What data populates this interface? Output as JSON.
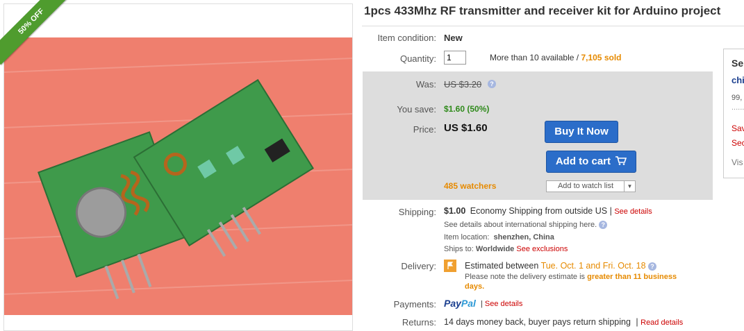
{
  "badge": {
    "discount": "50% OFF"
  },
  "product": {
    "title": "1pcs 433Mhz RF transmitter and receiver kit for Arduino project"
  },
  "condition": {
    "label": "Item condition:",
    "value": "New"
  },
  "quantity": {
    "label": "Quantity:",
    "value": "1",
    "available": "More than 10 available",
    "divider": "/",
    "sold": "7,105 sold"
  },
  "pricing": {
    "was_label": "Was:",
    "was_value": "US $3.20",
    "save_label": "You save:",
    "save_value": "$1.60 (50%)",
    "price_label": "Price:",
    "price_value": "US $1.60",
    "watchers": "485 watchers"
  },
  "actions": {
    "buy_now": "Buy It Now",
    "add_to_cart": "Add to cart",
    "watch": "Add to watch list"
  },
  "shipping": {
    "label": "Shipping:",
    "cost": "$1.00",
    "method": "Economy Shipping from outside US",
    "divider": "|",
    "see_details": "See details",
    "international": "See details about international shipping here.",
    "location_label": "Item location:",
    "location": "shenzhen, China",
    "ships_to_label": "Ships to:",
    "ships_to": "Worldwide",
    "exclusions": "See exclusions"
  },
  "delivery": {
    "label": "Delivery:",
    "estimated": "Estimated between",
    "dates": "Tue. Oct. 1 and Fri. Oct. 18",
    "note": "Please note the delivery estimate is",
    "note_highlight": "greater than 11 business",
    "note_end": "days."
  },
  "payments": {
    "label": "Payments:",
    "brand_pay": "Pay",
    "brand_pal": "Pal",
    "divider": "|",
    "see_details": "See details"
  },
  "returns": {
    "label": "Returns:",
    "policy": "14 days money back, buyer pays return shipping",
    "divider": "|",
    "read_details": "Read details"
  },
  "seller_panel": {
    "heading": "Se",
    "name": "chi",
    "score": "99,",
    "dots": ".......",
    "link1": "Sav",
    "link2": "Sec",
    "link3": "Vis"
  },
  "colors": {
    "accent": "#2b6dc9",
    "badge": "#4f9c2e",
    "price_box": "#dddddd",
    "sold": "#e68a00",
    "save": "#2f8a1b",
    "link": "#cc0000"
  }
}
